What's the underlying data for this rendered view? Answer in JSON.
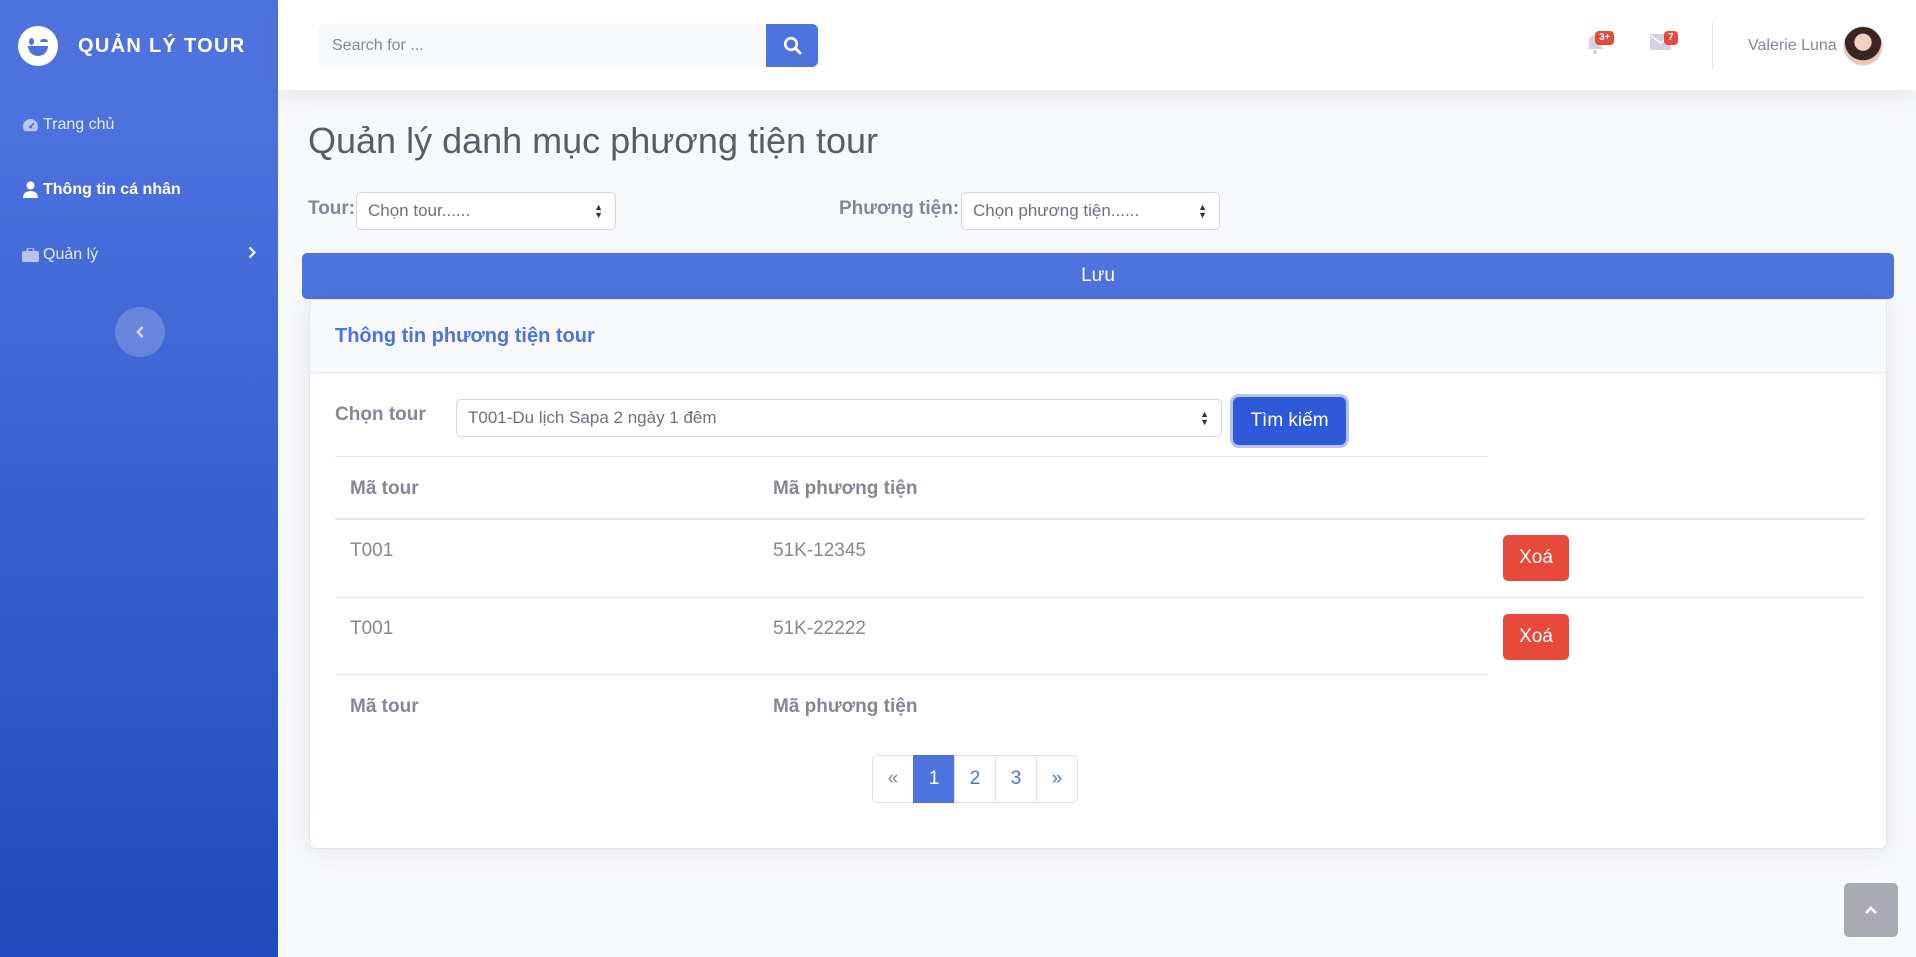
{
  "sidebar": {
    "brand": "QUẢN LÝ TOUR",
    "items": [
      {
        "label": "Trang chủ",
        "icon": "tachometer-icon"
      },
      {
        "label": "Thông tin cá nhân",
        "icon": "user-icon"
      },
      {
        "label": "Quản lý",
        "icon": "briefcase-icon"
      }
    ]
  },
  "topbar": {
    "search_placeholder": "Search for ...",
    "alerts_badge": "3+",
    "messages_badge": "7",
    "user_name": "Valerie Luna"
  },
  "page": {
    "title": "Quản lý danh mục phương tiện tour",
    "tour_label": "Tour:",
    "tour_select": "Chọn tour......",
    "vehicle_label": "Phương tiện:",
    "vehicle_select": "Chọn phương tiện......",
    "save_label": "Lưu"
  },
  "card": {
    "title": "Thông tin phương tiện tour",
    "choose_tour_label": "Chọn tour",
    "choose_tour_value": "T001-Du lịch Sapa 2 ngày 1 đêm",
    "search_button": "Tìm kiếm",
    "columns": [
      "Mã tour",
      "Mã phương tiện"
    ],
    "rows": [
      {
        "tour": "T001",
        "vehicle": "51K-12345",
        "action": "Xoá"
      },
      {
        "tour": "T001",
        "vehicle": "51K-22222",
        "action": "Xoá"
      }
    ],
    "footer_columns": [
      "Mã tour",
      "Mã phương tiện"
    ],
    "pagination": [
      "«",
      "1",
      "2",
      "3",
      "»"
    ]
  },
  "colors": {
    "primary": "#4e73df",
    "danger": "#e74a3b",
    "text": "#858796"
  }
}
